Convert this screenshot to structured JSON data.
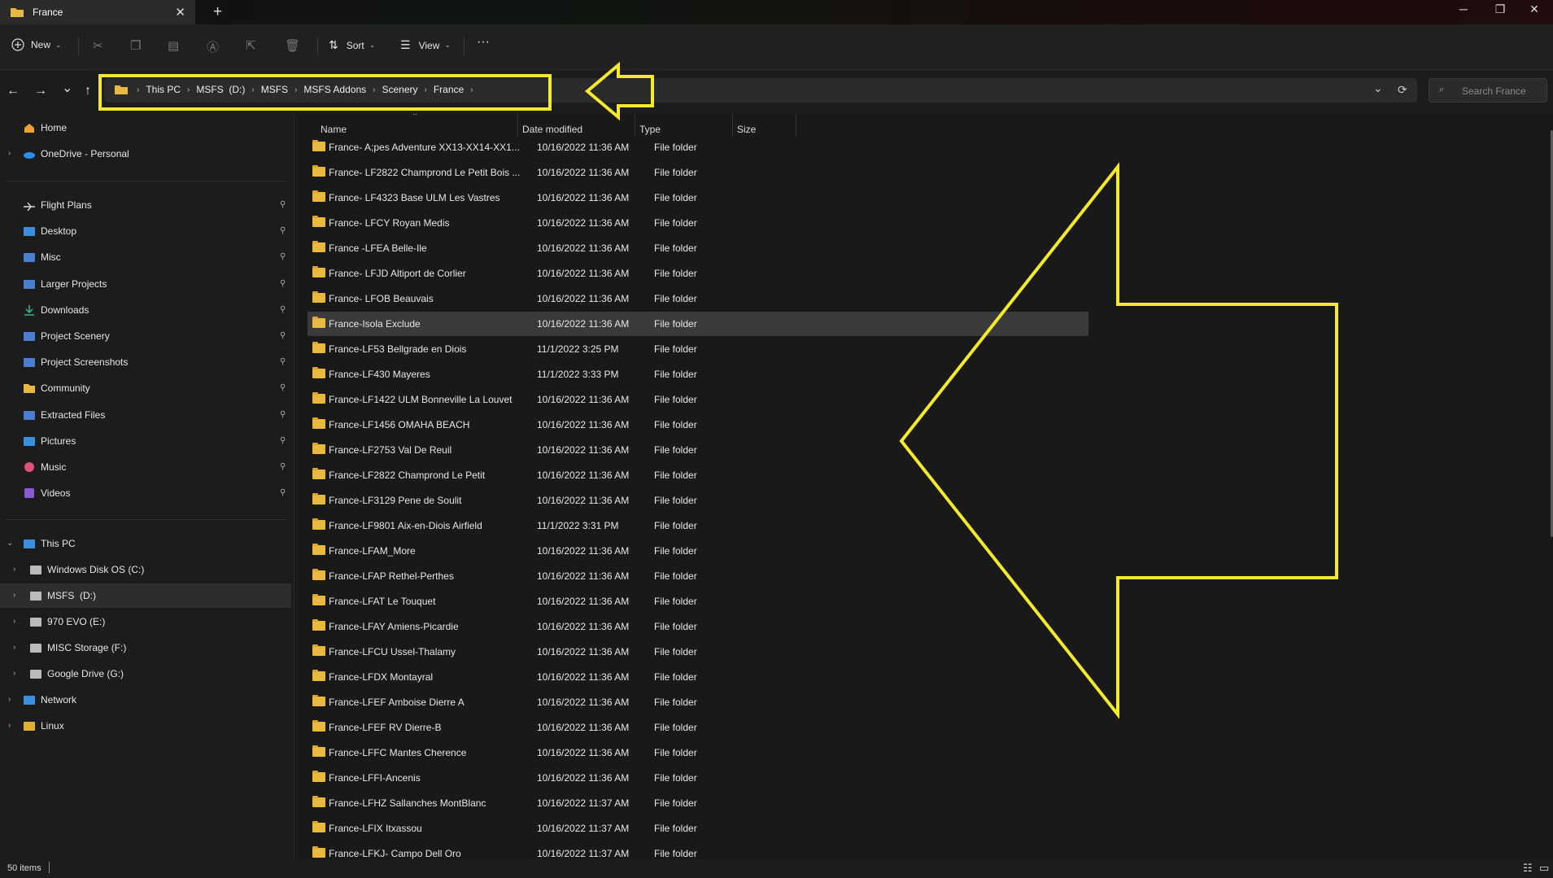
{
  "window": {
    "tab_title": "France",
    "close_tab_glyph": "✕",
    "new_tab_glyph": "+",
    "minimize_glyph": "─",
    "maximize_glyph": "❐",
    "close_glyph": "✕"
  },
  "toolbar": {
    "new_label": "New",
    "sort_label": "Sort",
    "view_label": "View",
    "more_glyph": "···"
  },
  "nav": {
    "back_glyph": "←",
    "forward_glyph": "→",
    "recent_glyph": "⌄",
    "up_glyph": "↑",
    "dropdown_glyph": "⌄",
    "refresh_glyph": "⟳"
  },
  "breadcrumb": [
    "This PC",
    "MSFS  (D:)",
    "MSFS",
    "MSFS Addons",
    "Scenery",
    "France"
  ],
  "search": {
    "placeholder": "Search France"
  },
  "sidebar": {
    "top": [
      {
        "label": "Home",
        "icon": "home-icon",
        "color": "#f0a030"
      },
      {
        "label": "OneDrive - Personal",
        "icon": "cloud-icon",
        "color": "#2d8ef0"
      }
    ],
    "quick": [
      {
        "label": "Flight Plans",
        "icon": "plane-icon",
        "color": "#dddddd"
      },
      {
        "label": "Desktop",
        "icon": "desktop-icon",
        "color": "#3b8fe0"
      },
      {
        "label": "Misc",
        "icon": "misc-icon",
        "color": "#4a7fd0"
      },
      {
        "label": "Larger Projects",
        "icon": "folder-blue-icon",
        "color": "#4a7fd0"
      },
      {
        "label": "Downloads",
        "icon": "download-icon",
        "color": "#2fb38f"
      },
      {
        "label": "Project Scenery",
        "icon": "folder-blue-icon",
        "color": "#4a7fd0"
      },
      {
        "label": "Project Screenshots",
        "icon": "folder-blue-icon",
        "color": "#4a7fd0"
      },
      {
        "label": "Community",
        "icon": "folder-icon",
        "color": "#e8b93e"
      },
      {
        "label": "Extracted Files",
        "icon": "folder-blue-icon",
        "color": "#4a7fd0"
      },
      {
        "label": "Pictures",
        "icon": "pictures-icon",
        "color": "#3b8fe0"
      },
      {
        "label": "Music",
        "icon": "music-icon",
        "color": "#e0507a"
      },
      {
        "label": "Videos",
        "icon": "videos-icon",
        "color": "#8a5ad0"
      }
    ],
    "this_pc": "This PC",
    "drives": [
      {
        "label": "Windows Disk OS (C:)",
        "selected": false
      },
      {
        "label": "MSFS  (D:)",
        "selected": true
      },
      {
        "label": "970 EVO (E:)",
        "selected": false
      },
      {
        "label": "MISC Storage (F:)",
        "selected": false
      },
      {
        "label": "Google Drive (G:)",
        "selected": false
      }
    ],
    "network": "Network",
    "linux": "Linux"
  },
  "columns": {
    "name": "Name",
    "date": "Date modified",
    "type": "Type",
    "size": "Size"
  },
  "files": [
    {
      "name": "France- A;pes Adventure XX13-XX14-XX1...",
      "date": "10/16/2022 11:36 AM",
      "type": "File folder"
    },
    {
      "name": "France- LF2822 Champrond Le Petit Bois ...",
      "date": "10/16/2022 11:36 AM",
      "type": "File folder"
    },
    {
      "name": "France- LF4323 Base ULM Les Vastres",
      "date": "10/16/2022 11:36 AM",
      "type": "File folder"
    },
    {
      "name": "France- LFCY Royan Medis",
      "date": "10/16/2022 11:36 AM",
      "type": "File folder"
    },
    {
      "name": "France -LFEA Belle-Ile",
      "date": "10/16/2022 11:36 AM",
      "type": "File folder"
    },
    {
      "name": "France- LFJD Altiport de Corlier",
      "date": "10/16/2022 11:36 AM",
      "type": "File folder"
    },
    {
      "name": "France- LFOB Beauvais",
      "date": "10/16/2022 11:36 AM",
      "type": "File folder"
    },
    {
      "name": "France-Isola Exclude",
      "date": "10/16/2022 11:36 AM",
      "type": "File folder",
      "selected": true
    },
    {
      "name": "France-LF53 Bellgrade en Diois",
      "date": "11/1/2022 3:25 PM",
      "type": "File folder"
    },
    {
      "name": "France-LF430 Mayeres",
      "date": "11/1/2022 3:33 PM",
      "type": "File folder"
    },
    {
      "name": "France-LF1422 ULM Bonneville La Louvet",
      "date": "10/16/2022 11:36 AM",
      "type": "File folder"
    },
    {
      "name": "France-LF1456 OMAHA BEACH",
      "date": "10/16/2022 11:36 AM",
      "type": "File folder"
    },
    {
      "name": "France-LF2753 Val De Reuil",
      "date": "10/16/2022 11:36 AM",
      "type": "File folder"
    },
    {
      "name": "France-LF2822 Champrond Le Petit",
      "date": "10/16/2022 11:36 AM",
      "type": "File folder"
    },
    {
      "name": "France-LF3129 Pene de Soulit",
      "date": "10/16/2022 11:36 AM",
      "type": "File folder"
    },
    {
      "name": "France-LF9801 Aix-en-Diois Airfield",
      "date": "11/1/2022 3:31 PM",
      "type": "File folder"
    },
    {
      "name": "France-LFAM_More",
      "date": "10/16/2022 11:36 AM",
      "type": "File folder"
    },
    {
      "name": "France-LFAP Rethel-Perthes",
      "date": "10/16/2022 11:36 AM",
      "type": "File folder"
    },
    {
      "name": "France-LFAT Le Touquet",
      "date": "10/16/2022 11:36 AM",
      "type": "File folder"
    },
    {
      "name": "France-LFAY Amiens-Picardie",
      "date": "10/16/2022 11:36 AM",
      "type": "File folder"
    },
    {
      "name": "France-LFCU  Ussel-Thalamy",
      "date": "10/16/2022 11:36 AM",
      "type": "File folder"
    },
    {
      "name": "France-LFDX Montayral",
      "date": "10/16/2022 11:36 AM",
      "type": "File folder"
    },
    {
      "name": "France-LFEF Amboise Dierre A",
      "date": "10/16/2022 11:36 AM",
      "type": "File folder"
    },
    {
      "name": "France-LFEF RV Dierre-B",
      "date": "10/16/2022 11:36 AM",
      "type": "File folder"
    },
    {
      "name": "France-LFFC Mantes Cherence",
      "date": "10/16/2022 11:36 AM",
      "type": "File folder"
    },
    {
      "name": "France-LFFI-Ancenis",
      "date": "10/16/2022 11:36 AM",
      "type": "File folder"
    },
    {
      "name": "France-LFHZ Sallanches MontBlanc",
      "date": "10/16/2022 11:37 AM",
      "type": "File folder"
    },
    {
      "name": "France-LFIX Itxassou",
      "date": "10/16/2022 11:37 AM",
      "type": "File folder"
    },
    {
      "name": "France-LFKJ- Campo Dell Oro",
      "date": "10/16/2022 11:37 AM",
      "type": "File folder"
    }
  ],
  "status": {
    "items_count": "50 items"
  },
  "annotation_color": "#f2ea2a"
}
